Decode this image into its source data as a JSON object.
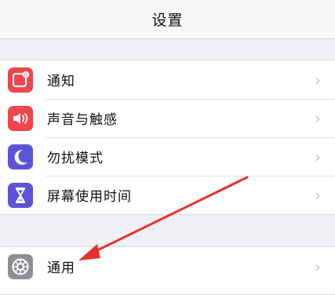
{
  "navbar": {
    "title": "设置"
  },
  "group1": [
    {
      "label": "通知",
      "icon": "notifications-icon",
      "color": "#f0454b"
    },
    {
      "label": "声音与触感",
      "icon": "sounds-icon",
      "color": "#f0454b"
    },
    {
      "label": "勿扰模式",
      "icon": "moon-icon",
      "color": "#5b55d6"
    },
    {
      "label": "屏幕使用时间",
      "icon": "hourglass-icon",
      "color": "#5b55d6"
    }
  ],
  "group2": [
    {
      "label": "通用",
      "icon": "gear-icon",
      "color": "#8e8e93"
    }
  ],
  "chevron": "›",
  "annotation": {
    "color": "#e5322d"
  }
}
